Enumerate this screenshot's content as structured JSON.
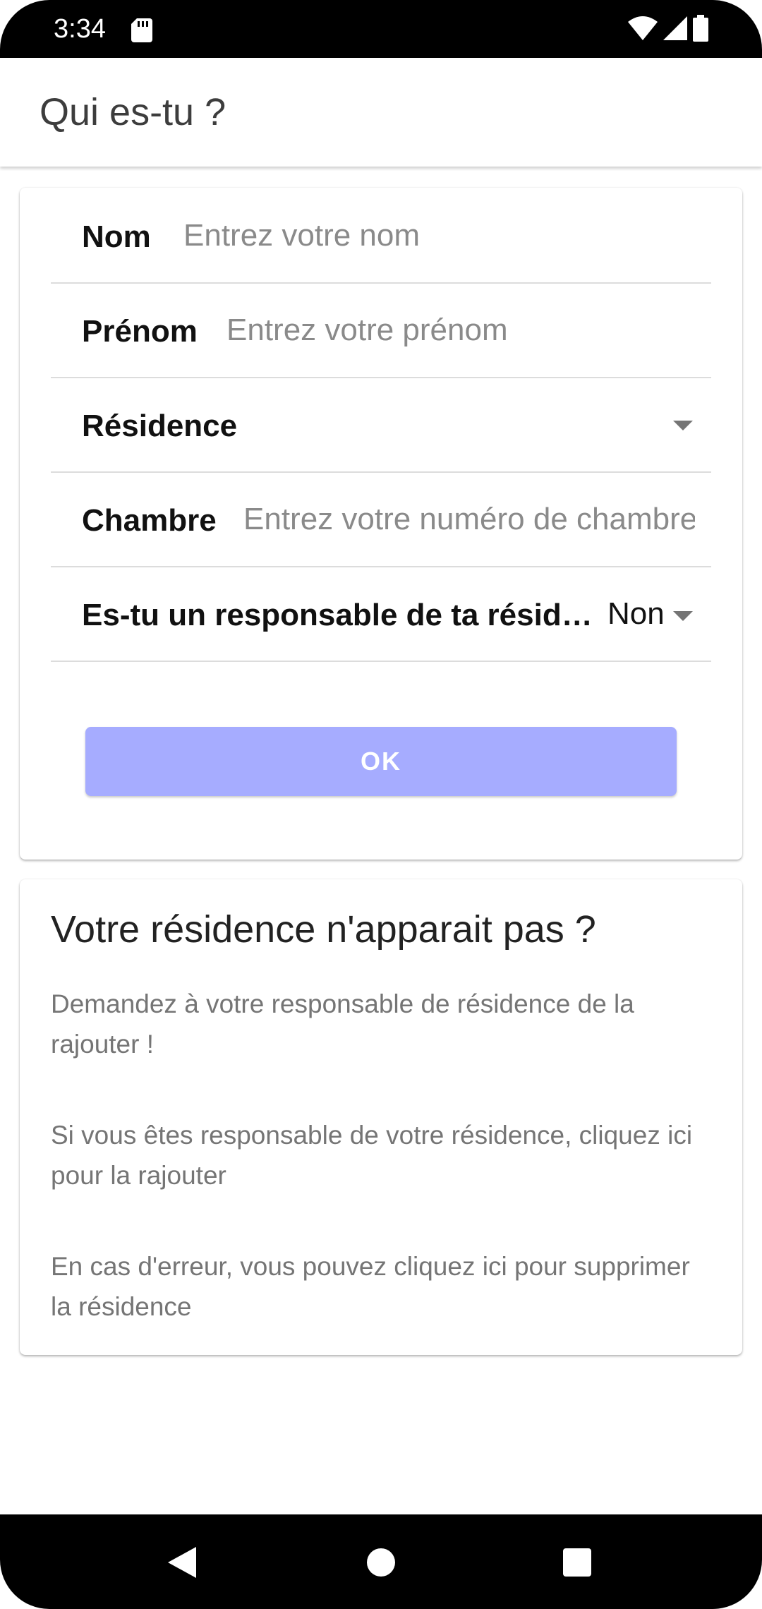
{
  "status_bar": {
    "time": "3:34",
    "icons": [
      "sd-card-icon",
      "wifi-icon",
      "cell-signal-icon",
      "battery-icon"
    ]
  },
  "app_bar": {
    "title": "Qui es-tu ?"
  },
  "form": {
    "nom": {
      "label": "Nom",
      "value": "",
      "placeholder": "Entrez votre nom"
    },
    "prenom": {
      "label": "Prénom",
      "value": "",
      "placeholder": "Entrez votre prénom"
    },
    "residence": {
      "label": "Résidence",
      "selected": ""
    },
    "chambre": {
      "label": "Chambre",
      "value": "",
      "placeholder": "Entrez votre numéro de chambre"
    },
    "responsable": {
      "label": "Es-tu un responsable de ta résid…",
      "selected": "Non"
    },
    "ok_label": "OK"
  },
  "info": {
    "title": "Votre résidence n'apparait pas ?",
    "paragraphs": [
      {
        "line1": "Demandez à votre responsable de résidence de la",
        "line2": "rajouter !"
      },
      {
        "line1": "Si vous êtes responsable de votre résidence, cliquez ici",
        "line2": "pour la rajouter"
      },
      {
        "line1": "En cas d'erreur, vous pouvez cliquez ici pour supprimer",
        "line2": "la résidence"
      }
    ]
  },
  "nav_bar": {
    "icons": [
      "back-icon",
      "home-icon",
      "recents-icon"
    ]
  },
  "colors": {
    "ok_button": "#a6acff",
    "placeholder": "#8a8a8a",
    "secondary_text": "#757575"
  }
}
